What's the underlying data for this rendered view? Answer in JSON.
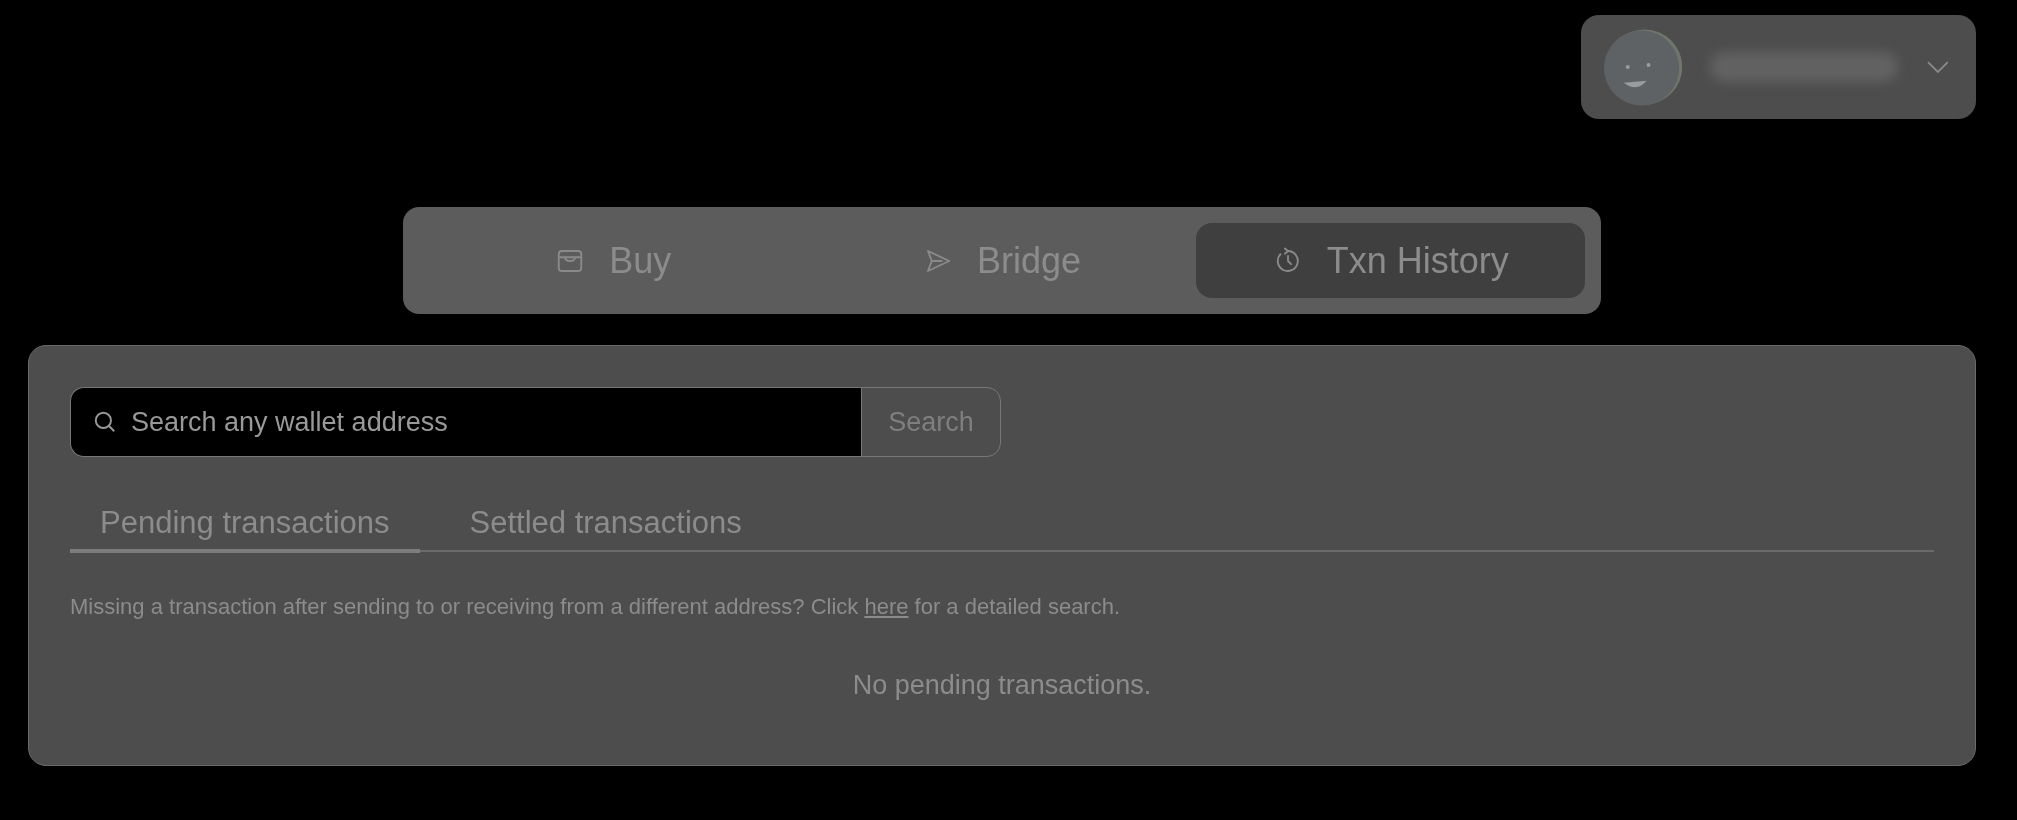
{
  "account": {
    "expanded": false
  },
  "nav_tabs": [
    {
      "label": "Buy",
      "kind": "wallet",
      "selected": false
    },
    {
      "label": "Bridge",
      "kind": "send",
      "selected": false
    },
    {
      "label": "Txn History",
      "kind": "history",
      "selected": true
    }
  ],
  "search": {
    "placeholder": "Search any wallet address",
    "button": "Search"
  },
  "list_tabs": [
    {
      "label": "Pending transactions",
      "selected": true
    },
    {
      "label": "Settled transactions",
      "selected": false
    }
  ],
  "help": {
    "before": "Missing a transaction after sending to or receiving from a different address? Click",
    "link": "here",
    "after": "for a detailed search."
  },
  "empty_message": "No pending transactions."
}
